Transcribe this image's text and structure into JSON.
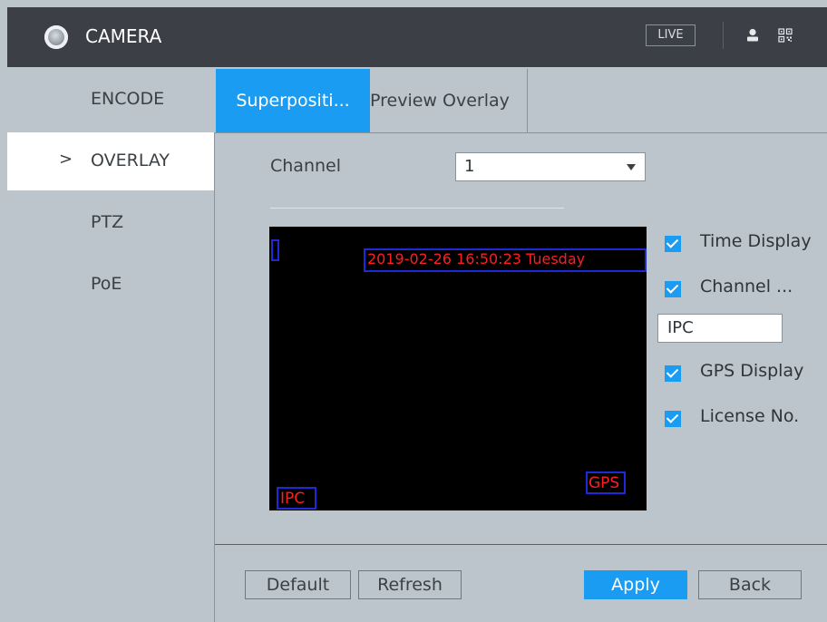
{
  "header": {
    "title": "CAMERA",
    "live_label": "LIVE",
    "icons": [
      "camera-logo-icon",
      "user-icon",
      "qr-code-icon"
    ]
  },
  "sidebar": {
    "items": [
      {
        "label": "ENCODE",
        "active": false
      },
      {
        "label": "OVERLAY",
        "active": true,
        "chevron": ">"
      },
      {
        "label": "PTZ",
        "active": false
      },
      {
        "label": "PoE",
        "active": false
      }
    ]
  },
  "tabs": [
    {
      "label": "Superpositi...",
      "active": true
    },
    {
      "label": "Preview Overlay",
      "active": false
    }
  ],
  "channel": {
    "label": "Channel",
    "value": "1"
  },
  "preview": {
    "timestamp": "2019-02-26 16:50:23 Tuesday",
    "channel_text": "IPC",
    "gps_text": "GPS",
    "small_box_text": ""
  },
  "options": {
    "time_display": {
      "label": "Time Display",
      "checked": true
    },
    "channel_display": {
      "label": "Channel ...",
      "checked": true
    },
    "channel_name_value": "IPC",
    "gps_display": {
      "label": "GPS Display",
      "checked": true
    },
    "license_no": {
      "label": "License No.",
      "checked": true
    }
  },
  "buttons": {
    "default": "Default",
    "refresh": "Refresh",
    "apply": "Apply",
    "back": "Back"
  },
  "colors": {
    "accent": "#1a9cf2",
    "titlebar": "#3c3f45",
    "panel": "#bcc5cb",
    "overlay_text": "#ff1e1e",
    "overlay_box": "#1e2ad6"
  }
}
